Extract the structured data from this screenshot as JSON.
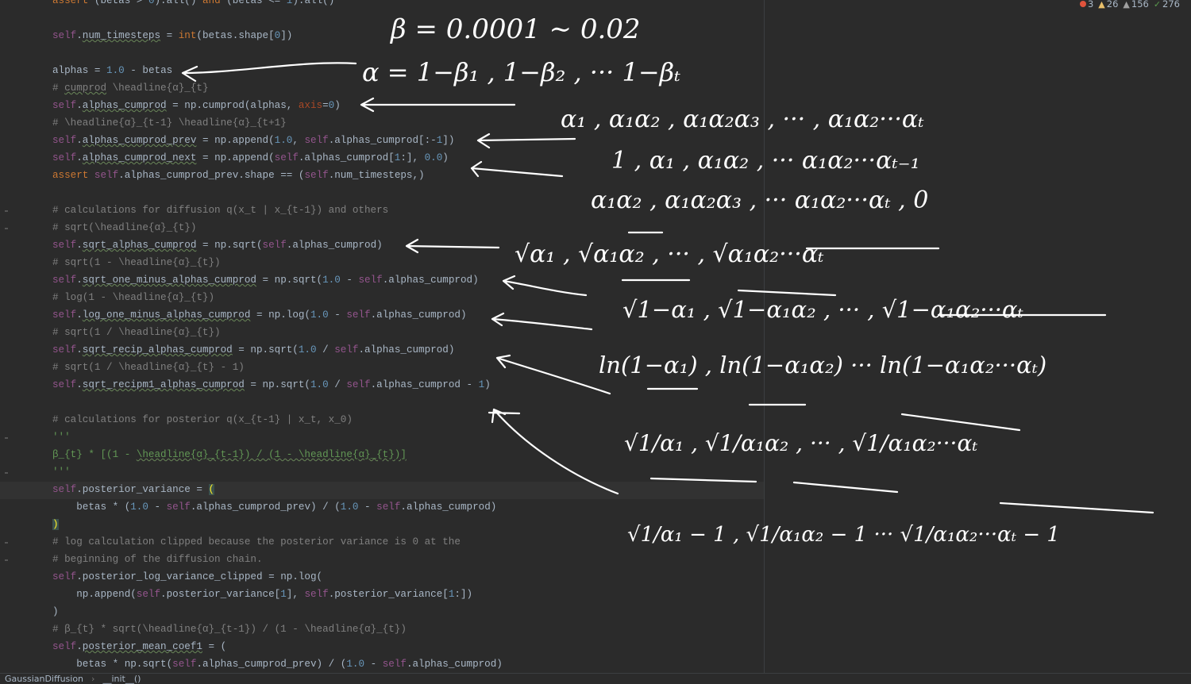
{
  "editor": {
    "inspections": {
      "errors": "3",
      "warnings": "26",
      "weak_warnings": "156",
      "typos": "276"
    },
    "breadcrumb": {
      "class_name": "GaussianDiffusion",
      "method_name": "__init__()"
    }
  },
  "annotations": {
    "beta_range": "β = 0.0001 ∼ 0.02",
    "alphas": "α = 1−β₁ , 1−β₂ , ··· 1−βₜ",
    "alphas_cumprod": "α₁ , α₁α₂ , α₁α₂α₃ , ··· , α₁α₂···αₜ",
    "alphas_cumprod_prev": "1 , α₁ , α₁α₂ , ··· α₁α₂···αₜ₋₁",
    "alphas_cumprod_next": "α₁α₂ , α₁α₂α₃ , ··· α₁α₂···αₜ , 0",
    "sqrt_alphas_cumprod": "√α₁ , √α₁α₂ , ··· , √α₁α₂···αₜ",
    "sqrt_one_minus_alphas_cumprod": "√1−α₁ , √1−α₁α₂ , ··· , √1−α₁α₂···αₜ",
    "log_one_minus_alphas_cumprod": "ln(1−α₁) , ln(1−α₁α₂) ··· ln(1−α₁α₂···αₜ)",
    "sqrt_recip_alphas_cumprod": "√1/α₁ , √1/α₁α₂ , ··· , √1/α₁α₂···αₜ",
    "sqrt_recipm1_alphas_cumprod": "√1/α₁ − 1 , √1/α₁α₂ − 1 ··· √1/α₁α₂···αₜ − 1"
  }
}
